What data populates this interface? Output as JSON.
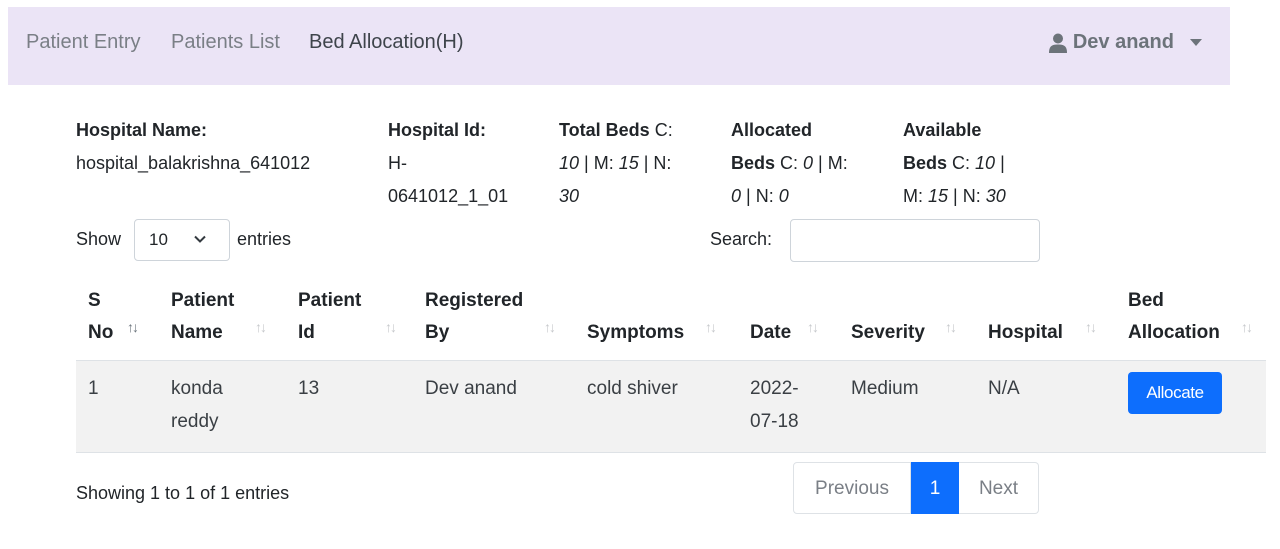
{
  "nav": {
    "links": [
      "Patient Entry",
      "Patients List",
      "Bed Allocation(H)"
    ],
    "user": "Dev anand"
  },
  "info": {
    "hospital_name_label": "Hospital Name:",
    "hospital_name": "hospital_balakrishna_641012",
    "hospital_id_label": "Hospital Id:",
    "hospital_id_line1": "H-",
    "hospital_id_line2": "0641012_1_01",
    "total_beds": {
      "label": "Total Beds",
      "C": "10",
      "M": "15",
      "N": "30"
    },
    "allocated_beds": {
      "label1": "Allocated",
      "label2": "Beds",
      "C": "0",
      "M": "0",
      "N": "0"
    },
    "available_beds": {
      "label1": "Available",
      "label2": "Beds",
      "C": "10",
      "M": "15",
      "N": "30"
    }
  },
  "controls": {
    "show_label": "Show",
    "page_size": "10",
    "entries_label": "entries",
    "search_label": "Search:",
    "search_value": ""
  },
  "table": {
    "headers": [
      [
        "S",
        "No"
      ],
      [
        "Patient",
        "Name"
      ],
      [
        "Patient",
        "Id"
      ],
      [
        "Registered",
        "By"
      ],
      [
        "",
        "Symptoms"
      ],
      [
        "",
        "Date"
      ],
      [
        "",
        "Severity"
      ],
      [
        "",
        "Hospital"
      ],
      [
        "Bed",
        "Allocation"
      ]
    ],
    "rows": [
      {
        "sno": "1",
        "name_line1": "konda",
        "name_line2": "reddy",
        "patient_id": "13",
        "registered_by": "Dev anand",
        "symptoms": "cold shiver",
        "date_line1": "2022-",
        "date_line2": "07-18",
        "severity": "Medium",
        "hospital": "N/A",
        "action": "Allocate"
      }
    ]
  },
  "footer": {
    "showing": "Showing 1 to 1 of 1 entries",
    "prev": "Previous",
    "current_page": "1",
    "next": "Next"
  },
  "colors": {
    "navbar_bg": "#ebe4f6",
    "primary": "#0d6efd",
    "row_stripe": "#f2f2f2"
  }
}
